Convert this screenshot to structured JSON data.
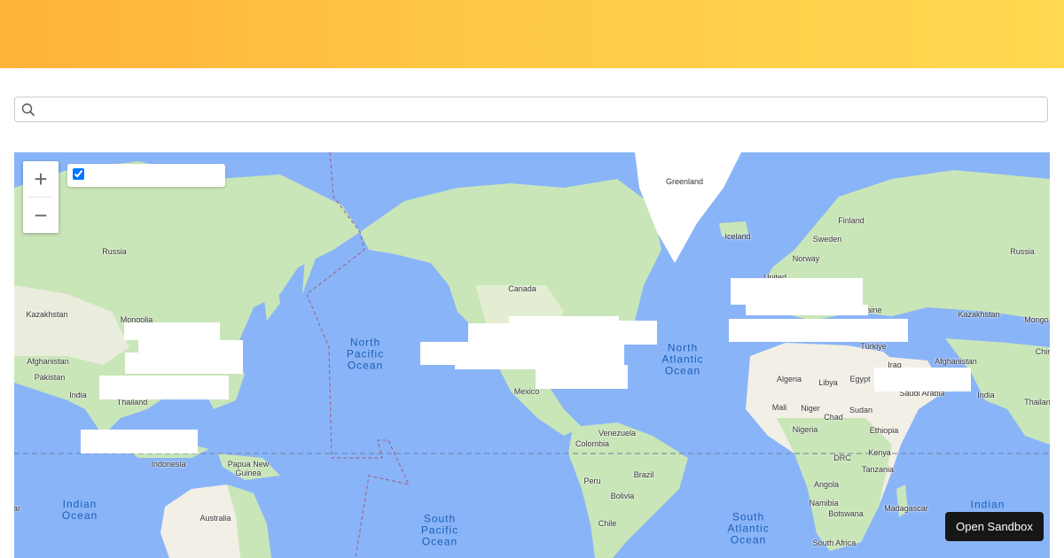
{
  "search": {
    "placeholder": "",
    "value": ""
  },
  "layer_control": {
    "label": "",
    "checked": true
  },
  "zoom": {
    "in_label": "+",
    "out_label": "−"
  },
  "sandbox_button": {
    "label": "Open Sandbox"
  },
  "map": {
    "colors": {
      "water": "#8ab4f8",
      "land": "#c9e6b8",
      "desert": "#f2efe6",
      "ice": "#ffffff"
    },
    "countries": {
      "greenland": "Greenland",
      "iceland": "Iceland",
      "finland": "Finland",
      "sweden": "Sweden",
      "norway": "Norway",
      "russia_west": "Russia",
      "russia_east": "Russia",
      "kazakhstan_west": "Kazakhstan",
      "kazakhstan_east": "Kazakhstan",
      "mongolia_west": "Mongolia",
      "mongolia_east": "Mongo",
      "afghanistan_west": "Afghanistan",
      "afghanistan_east": "Afghanistan",
      "pakistan": "Pakistan",
      "india_west": "India",
      "india_east": "India",
      "thailand_west": "Thailand",
      "thailand_east": "Thailan",
      "china": "China",
      "china_partial": "Chir",
      "indonesia": "Indonesia",
      "papua": "Papua New\nGuinea",
      "australia": "Australia",
      "canada": "Canada",
      "mexico": "Mexico",
      "venezuela": "Venezuela",
      "colombia": "Colombia",
      "peru": "Peru",
      "brazil": "Brazil",
      "bolivia": "Bolivia",
      "chile": "Chile",
      "algeria": "Algeria",
      "libya": "Libya",
      "egypt": "Egypt",
      "mali": "Mali",
      "niger": "Niger",
      "chad": "Chad",
      "sudan": "Sudan",
      "nigeria": "Nigeria",
      "ethiopia": "Ethiopia",
      "drc": "DRC",
      "kenya": "Kenya",
      "tanzania": "Tanzania",
      "angola": "Angola",
      "namibia": "Namibia",
      "botswana": "Botswana",
      "madagascar": "Madagascar",
      "south_africa": "South Africa",
      "turkiye": "Türkiye",
      "iraq": "Iraq",
      "saudi": "Saudi Arabia",
      "united": "United",
      "ukraine": "aine",
      "edge_left": "ar"
    },
    "oceans": {
      "north_pacific": "North\nPacific\nOcean",
      "north_atlantic": "North\nAtlantic\nOcean",
      "south_pacific": "South\nPacific\nOcean",
      "south_atlantic": "South\nAtlantic\nOcean",
      "indian_west": "Indian\nOcean",
      "indian_east": "Indian"
    }
  }
}
